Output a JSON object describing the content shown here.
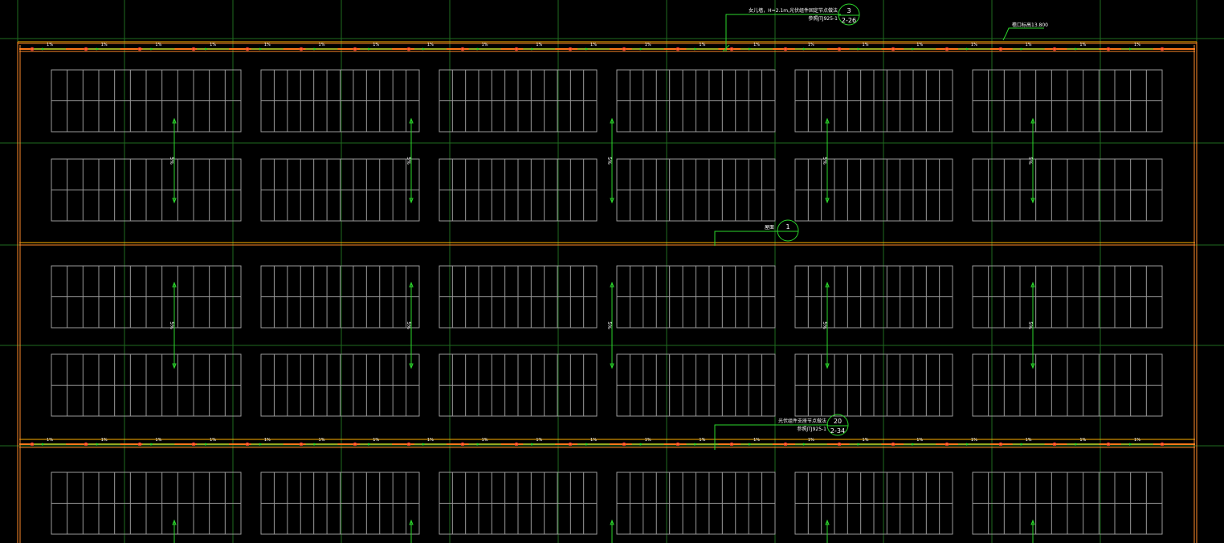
{
  "drawing": {
    "background": "#000000",
    "colors": {
      "grid_axis": "#1f6b1f",
      "gutter": "#ff7a1a",
      "gutter_edge": "#ffb000",
      "wall": "#ff8a2a",
      "panel": "#9a9a9a",
      "arrow": "#2bd62b",
      "leader": "#2bd62b",
      "text": "#ffffff",
      "drain": "#ff3b3b"
    },
    "panel_arrays": {
      "rows": 5,
      "columns": 6,
      "modules_per_array_row": 12,
      "module_rows_per_array": 2
    },
    "slope_labels": {
      "roof": "5%",
      "gutter": "1%"
    },
    "callouts": [
      {
        "id": "detail-3",
        "note": "女儿墙，H=2.1m,光伏组件固定节点做法",
        "ref": "参照JTJ925-1",
        "number": "3",
        "sheet": "2-26"
      },
      {
        "id": "detail-1",
        "note": "屋面",
        "number": "1",
        "sheet": ""
      },
      {
        "id": "detail-20",
        "note": "光伏组件支座节点做法",
        "ref": "参照JTJ925-1",
        "number": "20",
        "sheet": "2-34"
      }
    ],
    "elevation_note": "檐口标高13.800"
  }
}
